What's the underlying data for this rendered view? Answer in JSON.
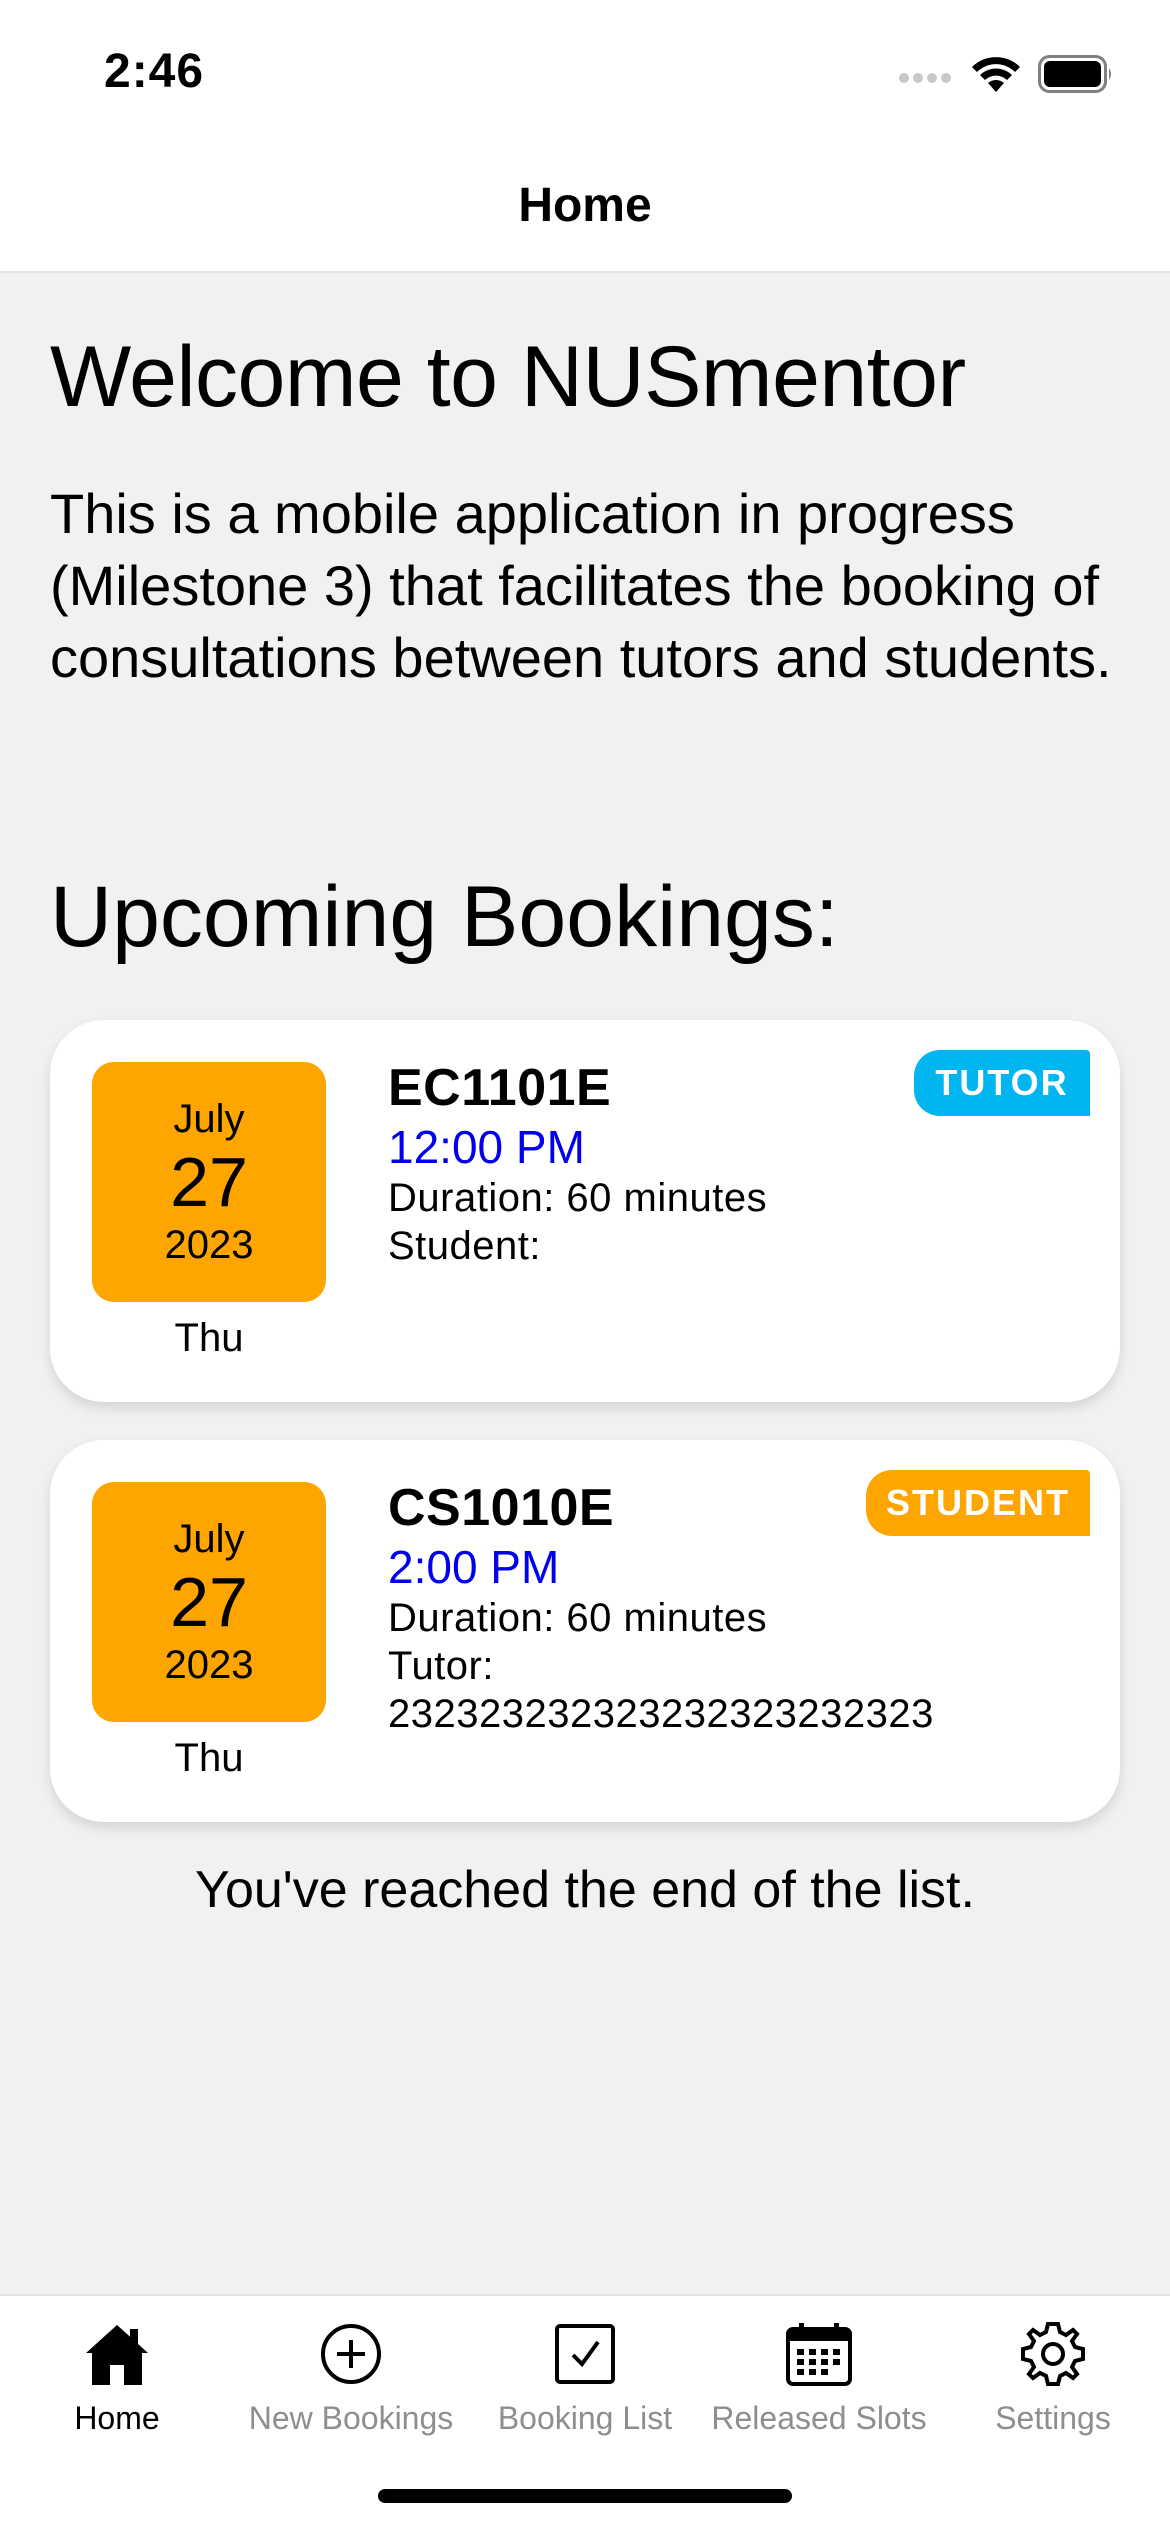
{
  "status_bar": {
    "time": "2:46"
  },
  "header": {
    "title": "Home"
  },
  "welcome": {
    "title": "Welcome to NUSmentor",
    "description": "This is a mobile application in progress (Milestone 3) that facilitates the booking of consultations between tutors and students."
  },
  "bookings_section": {
    "title": "Upcoming Bookings:"
  },
  "bookings": [
    {
      "month": "July",
      "day": "27",
      "year": "2023",
      "weekday": "Thu",
      "course": "EC1101E",
      "time": "12:00 PM",
      "duration": "Duration: 60 minutes",
      "person": "Student:",
      "person_id": "",
      "role": "TUTOR",
      "role_color": "#00b5f0"
    },
    {
      "month": "July",
      "day": "27",
      "year": "2023",
      "weekday": "Thu",
      "course": "CS1010E",
      "time": "2:00 PM",
      "duration": "Duration: 60 minutes",
      "person": "Tutor:",
      "person_id": "232323232323232323232323",
      "role": "STUDENT",
      "role_color": "#ffa500"
    }
  ],
  "end_message": "You've reached the end of the list.",
  "tabs": [
    {
      "label": "Home",
      "icon": "home-icon",
      "active": true
    },
    {
      "label": "New Bookings",
      "icon": "plus-circle-icon",
      "active": false
    },
    {
      "label": "Booking List",
      "icon": "checkbox-icon",
      "active": false
    },
    {
      "label": "Released Slots",
      "icon": "calendar-icon",
      "active": false
    },
    {
      "label": "Settings",
      "icon": "gear-icon",
      "active": false
    }
  ],
  "colors": {
    "date_box": "#ffa500",
    "time_text": "#0000ee",
    "tutor_badge": "#00b5f0",
    "student_badge": "#ffa500",
    "background": "#f1f1f1"
  }
}
